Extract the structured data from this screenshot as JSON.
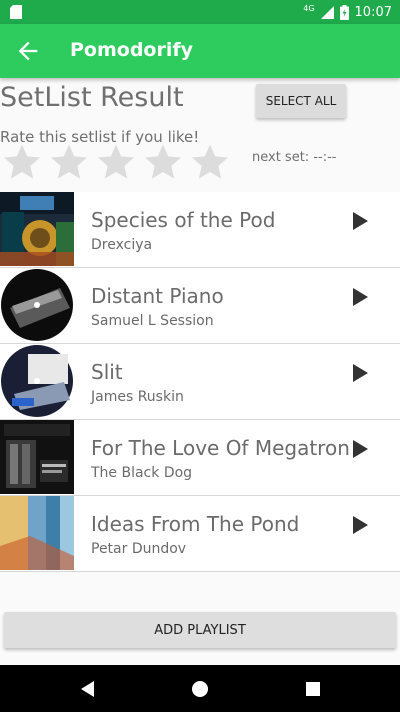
{
  "status_bar": {
    "network": "4G",
    "time": "10:07"
  },
  "app_bar": {
    "title": "Pomodorify"
  },
  "header": {
    "title": "SetList Result",
    "select_all_label": "SELECT ALL",
    "rate_text": "Rate this setlist if you like!",
    "rating_max": 5,
    "rating_value": 0,
    "next_set": "next set: --:--"
  },
  "tracks": [
    {
      "title": "Species of the Pod",
      "artist": "Drexciya"
    },
    {
      "title": "Distant Piano",
      "artist": "Samuel L Session"
    },
    {
      "title": "Slit",
      "artist": "James Ruskin"
    },
    {
      "title": "For The Love Of Megatron",
      "artist": "The Black Dog"
    },
    {
      "title": "Ideas From The Pond",
      "artist": "Petar Dundov"
    }
  ],
  "footer": {
    "add_playlist_label": "ADD PLAYLIST"
  },
  "colors": {
    "status_bar": "#1faa4c",
    "app_bar": "#2ecc5f",
    "star": "#dcdcdc"
  }
}
